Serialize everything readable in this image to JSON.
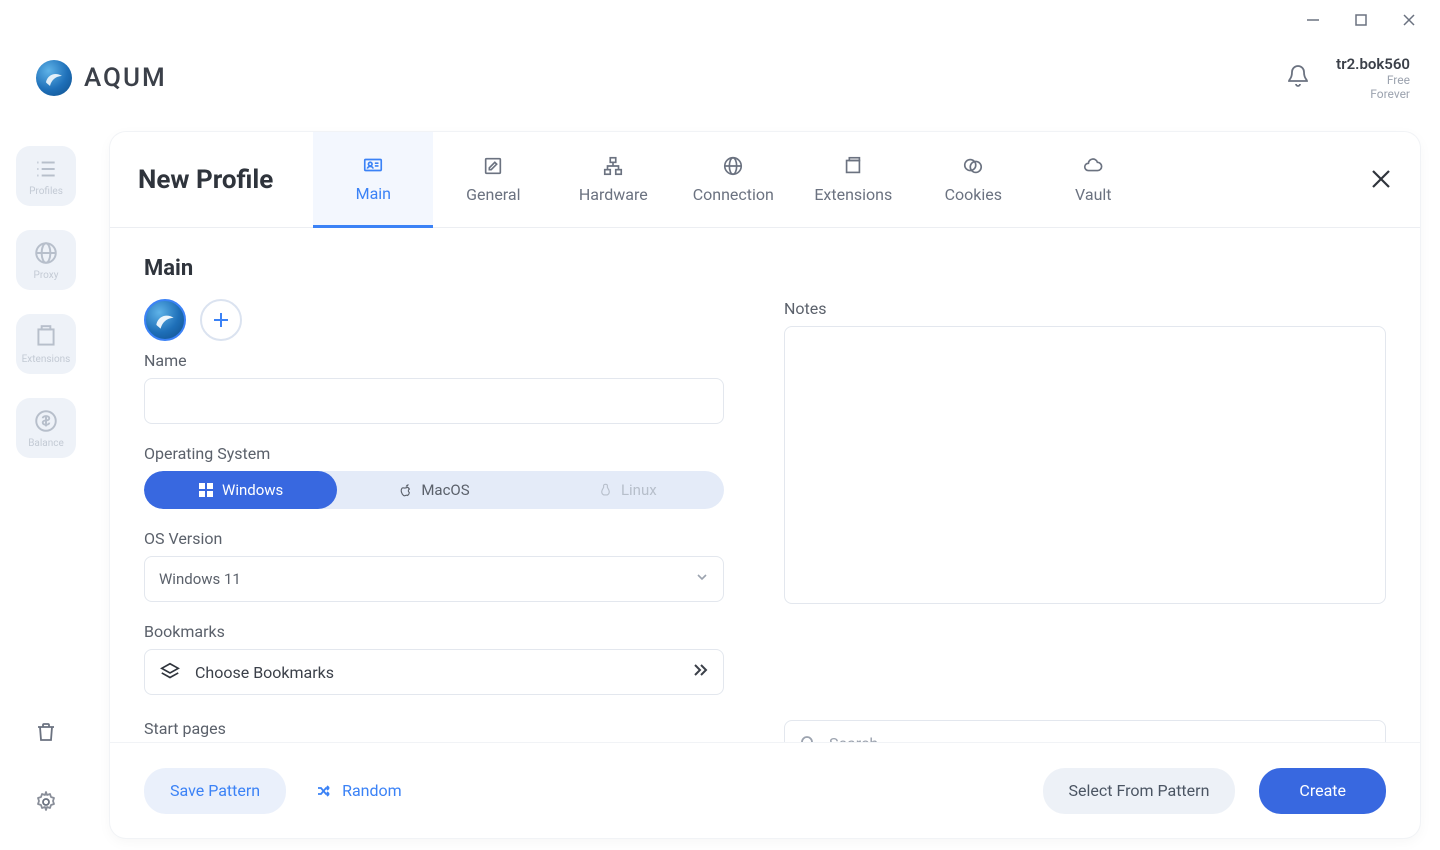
{
  "brand": "AQUM",
  "user": {
    "name": "tr2.bok560",
    "plan": "Free",
    "sub": "Forever"
  },
  "sidebar": {
    "items": [
      {
        "label": "Profiles"
      },
      {
        "label": "Proxy"
      },
      {
        "label": "Extensions"
      },
      {
        "label": "Balance"
      }
    ]
  },
  "panel": {
    "title": "New Profile",
    "tabs": [
      {
        "label": "Main",
        "active": true
      },
      {
        "label": "General"
      },
      {
        "label": "Hardware"
      },
      {
        "label": "Connection"
      },
      {
        "label": "Extensions"
      },
      {
        "label": "Cookies"
      },
      {
        "label": "Vault"
      }
    ]
  },
  "main": {
    "section_title": "Main",
    "name_label": "Name",
    "name_value": "",
    "os_label": "Operating System",
    "os_options": {
      "windows": "Windows",
      "macos": "MacOS",
      "linux": "Linux"
    },
    "os_version_label": "OS Version",
    "os_version_value": "Windows 11",
    "bookmarks_label": "Bookmarks",
    "bookmarks_button": "Choose Bookmarks",
    "startpages_label": "Start pages",
    "notes_label": "Notes",
    "notes_value": "",
    "search_placeholder": "Search"
  },
  "footer": {
    "save_pattern": "Save Pattern",
    "random": "Random",
    "select_from_pattern": "Select From Pattern",
    "create": "Create"
  }
}
